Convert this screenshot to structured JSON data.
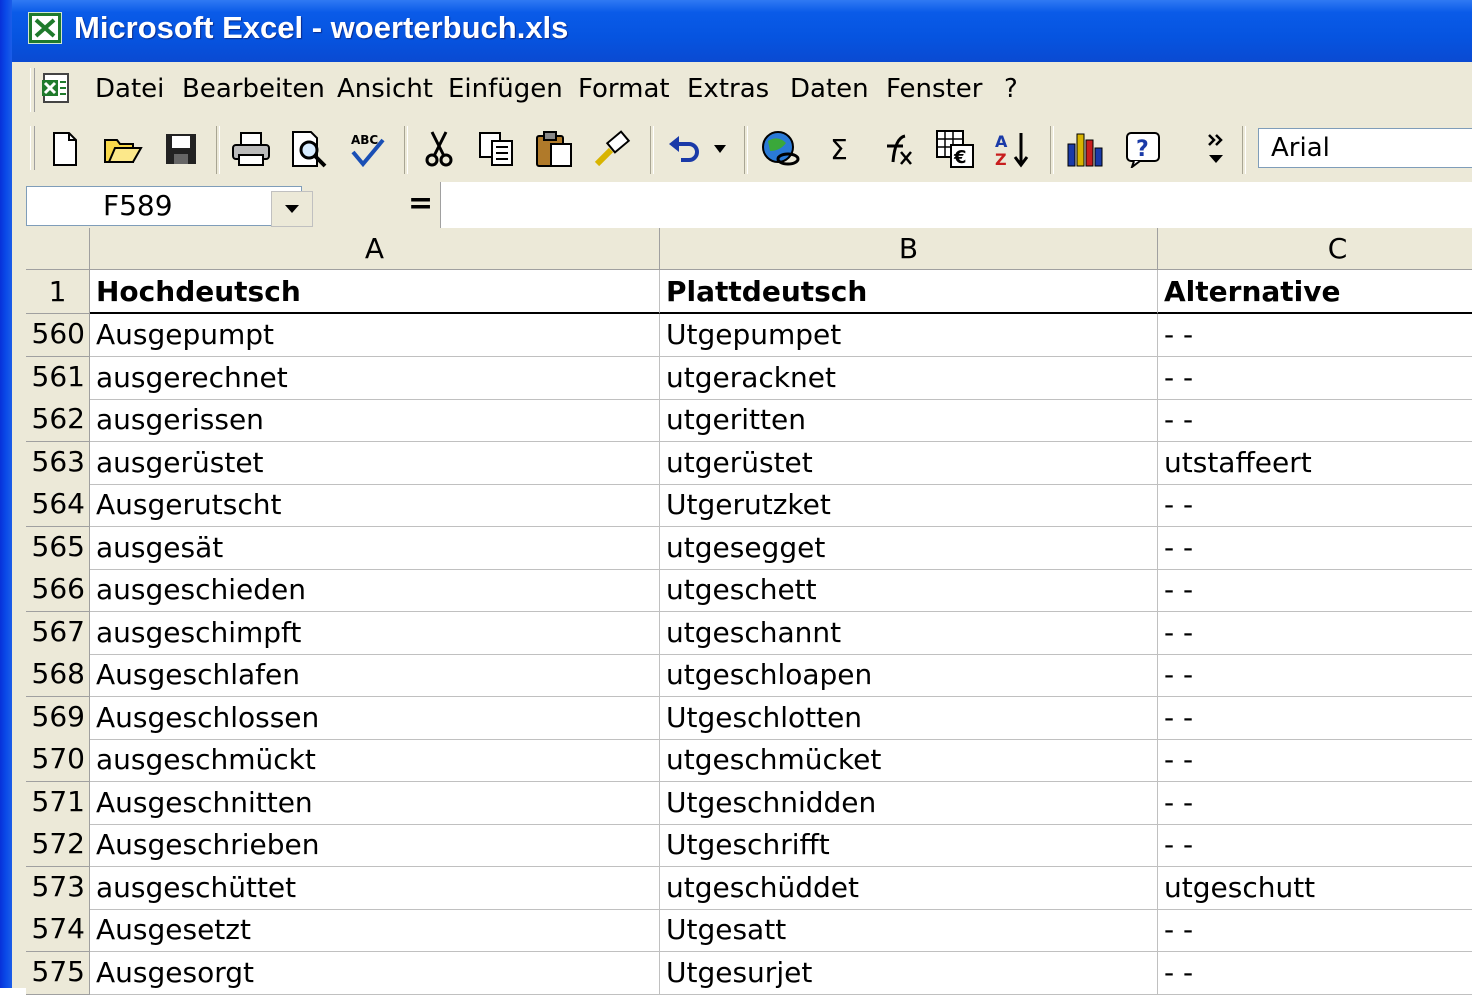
{
  "window": {
    "title": "Microsoft Excel - woerterbuch.xls"
  },
  "menu": {
    "items": [
      {
        "label": "Datei",
        "accel": "D"
      },
      {
        "label": "Bearbeiten",
        "accel": "B"
      },
      {
        "label": "Ansicht",
        "accel": "A"
      },
      {
        "label": "Einfügen",
        "accel": "E"
      },
      {
        "label": "Format",
        "accel": "t"
      },
      {
        "label": "Extras",
        "accel": "x"
      },
      {
        "label": "Daten",
        "accel": "n"
      },
      {
        "label": "Fenster",
        "accel": "F"
      },
      {
        "label": "?",
        "accel": "?"
      }
    ]
  },
  "toolbar": {
    "icons": [
      "new-icon",
      "open-icon",
      "save-icon",
      "print-icon",
      "print-preview-icon",
      "spellcheck-icon",
      "cut-icon",
      "copy-icon",
      "paste-icon",
      "format-painter-icon",
      "undo-icon",
      "undo-dropdown-icon",
      "hyperlink-icon",
      "autosum-icon",
      "function-icon",
      "euro-icon",
      "sort-ascending-icon",
      "chart-wizard-icon",
      "help-icon",
      "more-buttons-icon"
    ],
    "autosum_glyph": "Σ",
    "font": "Arial"
  },
  "formula_bar": {
    "name_box": "F589",
    "equals": "=",
    "formula": ""
  },
  "sheet": {
    "columns": [
      "A",
      "B",
      "C"
    ],
    "header_row": {
      "num": "1",
      "cells": [
        "Hochdeutsch",
        "Plattdeutsch",
        "Alternative"
      ]
    },
    "rows": [
      {
        "num": "560",
        "cells": [
          "Ausgepumpt",
          "Utgepumpet",
          "- -"
        ]
      },
      {
        "num": "561",
        "cells": [
          "ausgerechnet",
          "utgeracknet",
          "- -"
        ]
      },
      {
        "num": "562",
        "cells": [
          "ausgerissen",
          "utgeritten",
          "- -"
        ]
      },
      {
        "num": "563",
        "cells": [
          "ausgerüstet",
          "utgerüstet",
          "utstaffeert"
        ]
      },
      {
        "num": "564",
        "cells": [
          "Ausgerutscht",
          "Utgerutzket",
          "- -"
        ]
      },
      {
        "num": "565",
        "cells": [
          "ausgesät",
          "utgesegget",
          "- -"
        ]
      },
      {
        "num": "566",
        "cells": [
          "ausgeschieden",
          "utgeschett",
          "- -"
        ]
      },
      {
        "num": "567",
        "cells": [
          "ausgeschimpft",
          "utgeschannt",
          "- -"
        ]
      },
      {
        "num": "568",
        "cells": [
          "Ausgeschlafen",
          "utgeschloapen",
          "- -"
        ]
      },
      {
        "num": "569",
        "cells": [
          "Ausgeschlossen",
          "Utgeschlotten",
          "- -"
        ]
      },
      {
        "num": "570",
        "cells": [
          "ausgeschmückt",
          "utgeschmücket",
          "- -"
        ]
      },
      {
        "num": "571",
        "cells": [
          "Ausgeschnitten",
          "Utgeschnidden",
          "- -"
        ]
      },
      {
        "num": "572",
        "cells": [
          "Ausgeschrieben",
          "Utgeschrifft",
          "- -"
        ]
      },
      {
        "num": "573",
        "cells": [
          "ausgeschüttet",
          "utgeschüddet",
          "utgeschutt"
        ]
      },
      {
        "num": "574",
        "cells": [
          "Ausgesetzt",
          "Utgesatt",
          "- -"
        ]
      },
      {
        "num": "575",
        "cells": [
          "Ausgesorgt",
          "Utgesurjet",
          "- -"
        ]
      }
    ]
  }
}
